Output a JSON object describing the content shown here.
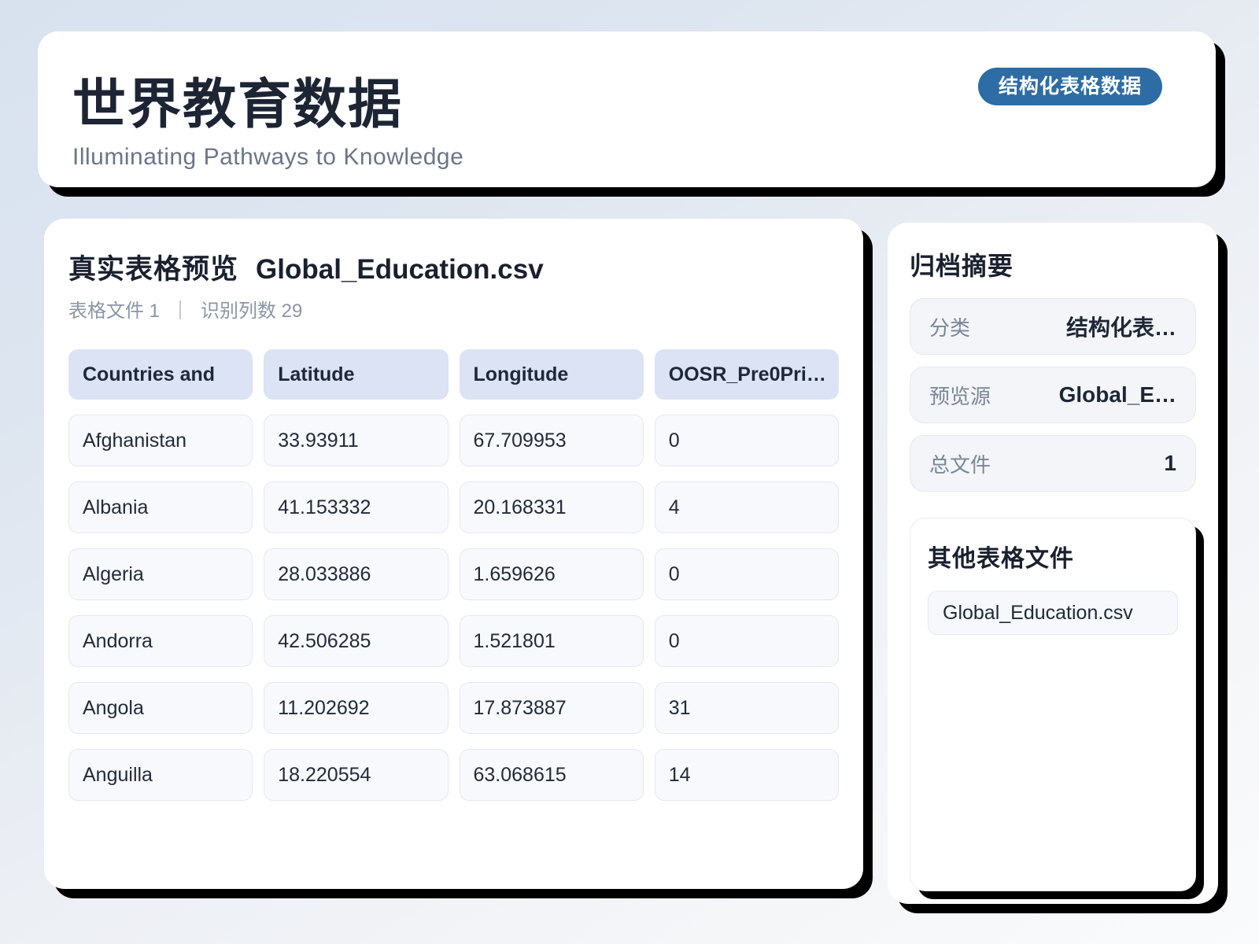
{
  "header": {
    "title": "世界教育数据",
    "subtitle": "Illuminating Pathways to Knowledge",
    "badge": "结构化表格数据",
    "badge_color": "#2d6ca4"
  },
  "preview": {
    "title": "真实表格预览",
    "file_name": "Global_Education.csv",
    "meta_files": "表格文件 1",
    "meta_divider": "｜",
    "meta_columns": "识别列数 29",
    "table": {
      "columns": [
        "Countries and",
        "Latitude",
        "Longitude",
        "OOSR_Pre0Pri…"
      ],
      "rows": [
        [
          "Afghanistan",
          "33.93911",
          "67.709953",
          "0"
        ],
        [
          "Albania",
          "41.153332",
          "20.168331",
          "4"
        ],
        [
          "Algeria",
          "28.033886",
          "1.659626",
          "0"
        ],
        [
          "Andorra",
          "42.506285",
          "1.521801",
          "0"
        ],
        [
          "Angola",
          "11.202692",
          "17.873887",
          "31"
        ],
        [
          "Anguilla",
          "18.220554",
          "63.068615",
          "14"
        ]
      ]
    }
  },
  "summary": {
    "title": "归档摘要",
    "stats": [
      {
        "label": "分类",
        "value": "结构化表…"
      },
      {
        "label": "预览源",
        "value": "Global_E…"
      },
      {
        "label": "总文件",
        "value": "1"
      }
    ]
  },
  "other_files": {
    "title": "其他表格文件",
    "items": [
      "Global_Education.csv"
    ]
  },
  "colors": {
    "accent_blue": "#2d6ca4",
    "header_cell_bg": "#dbe3f4",
    "card_shadow": "#000000"
  }
}
